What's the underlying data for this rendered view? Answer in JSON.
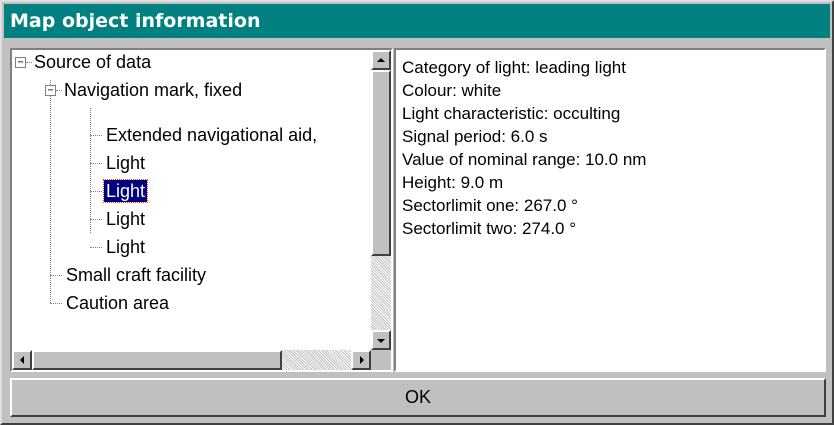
{
  "window": {
    "title": "Map object information",
    "titlebar_color": "#008080"
  },
  "tree": {
    "nodes": [
      {
        "label": "Source of data",
        "expander": "⊟",
        "selected": false
      },
      {
        "label": "Navigation mark, fixed",
        "expander": "⊟",
        "selected": false
      },
      {
        "label": "Extended navigational aid,",
        "selected": false
      },
      {
        "label": "Light",
        "selected": false
      },
      {
        "label": "Light",
        "selected": true
      },
      {
        "label": "Light",
        "selected": false
      },
      {
        "label": "Light",
        "selected": false
      },
      {
        "label": "Small craft facility",
        "selected": false
      },
      {
        "label": "Caution area",
        "selected": false
      }
    ],
    "selection_color": "#000080"
  },
  "info": {
    "lines": [
      "Category of light: leading light",
      "Colour: white",
      "Light characteristic: occulting",
      "Signal period: 6.0 s",
      "Value of nominal range: 10.0 nm",
      "Height: 9.0 m",
      "Sectorlimit one: 267.0 °",
      "Sectorlimit two: 274.0 °"
    ]
  },
  "buttons": {
    "ok_label": "OK"
  }
}
